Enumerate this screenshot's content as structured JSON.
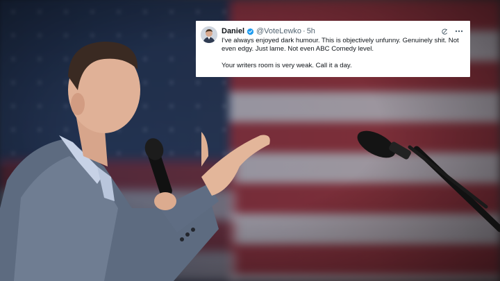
{
  "tweet": {
    "display_name": "Daniel",
    "handle": "@VoteLewko",
    "separator": "·",
    "time": "5h",
    "paragraphs": [
      "I've always enjoyed dark humour. This is objectively unfunny. Genuinely shit. Not even edgy. Just lame. Not even ABC Comedy level.",
      "Your writers room is very weak. Call it a day."
    ],
    "icons": {
      "verified": "verified-badge-icon",
      "grok": "grok-icon",
      "more": "more-options-icon"
    }
  },
  "colors": {
    "verified_blue": "#1d9bf0",
    "text_primary": "#0f1419",
    "text_secondary": "#536471",
    "card_background": "#ffffff"
  }
}
